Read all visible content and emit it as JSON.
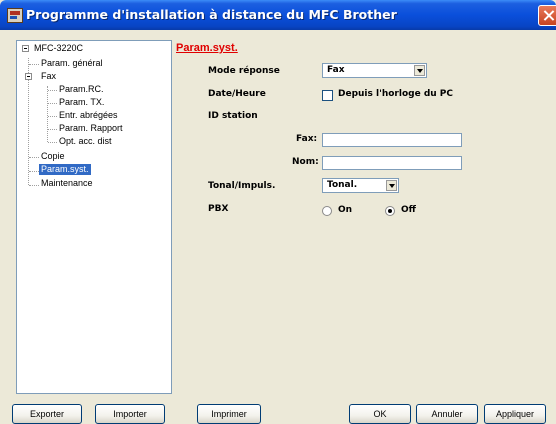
{
  "window": {
    "title": "Programme d'installation à distance du MFC Brother"
  },
  "tree": {
    "root": "MFC-3220C",
    "items": [
      "Param. général",
      "Fax",
      "Param.RC.",
      "Param. TX.",
      "Entr. abrégées",
      "Param. Rapport",
      "Opt. acc. dist",
      "Copie",
      "Param.syst.",
      "Maintenance"
    ],
    "selected": "Param.syst."
  },
  "panel": {
    "title": "Param.syst.",
    "mode_reponse": {
      "label": "Mode réponse",
      "value": "Fax"
    },
    "date_heure": {
      "label": "Date/Heure",
      "checkbox_label": "Depuis l'horloge du PC",
      "checked": false
    },
    "id_station": {
      "label": "ID station",
      "fax_label": "Fax:",
      "fax_value": "",
      "nom_label": "Nom:",
      "nom_value": ""
    },
    "tonal": {
      "label": "Tonal/Impuls.",
      "value": "Tonal."
    },
    "pbx": {
      "label": "PBX",
      "on_label": "On",
      "off_label": "Off",
      "selected": "Off"
    }
  },
  "buttons": {
    "exporter": "Exporter",
    "importer": "Importer",
    "imprimer": "Imprimer",
    "ok": "OK",
    "annuler": "Annuler",
    "appliquer": "Appliquer"
  }
}
